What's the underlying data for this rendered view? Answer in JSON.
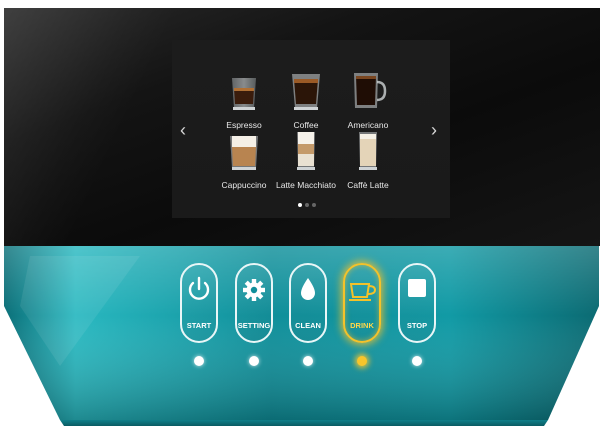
{
  "screen": {
    "nav_prev": "‹",
    "nav_next": "›",
    "drinks": [
      {
        "label": "Espresso",
        "icon": "espresso-cup-icon"
      },
      {
        "label": "Coffee",
        "icon": "coffee-cup-icon"
      },
      {
        "label": "Americano",
        "icon": "americano-mug-icon"
      },
      {
        "label": "Cappuccino",
        "icon": "cappuccino-cup-icon"
      },
      {
        "label": "Latte Macchiato",
        "icon": "latte-macchiato-glass-icon"
      },
      {
        "label": "Caffè Latte",
        "icon": "caffe-latte-glass-icon"
      }
    ],
    "pages": {
      "total": 3,
      "current": 1
    }
  },
  "controls": {
    "buttons": [
      {
        "label": "START",
        "icon": "power-icon",
        "active": false
      },
      {
        "label": "SETTING",
        "icon": "gear-icon",
        "active": false
      },
      {
        "label": "CLEAN",
        "icon": "water-drop-icon",
        "active": false
      },
      {
        "label": "DRINK",
        "icon": "cup-icon",
        "active": true
      },
      {
        "label": "STOP",
        "icon": "stop-square-icon",
        "active": false
      }
    ]
  },
  "colors": {
    "accent": "#f4c22a",
    "teal": "#12a5b0",
    "screen_bg": "#111111"
  }
}
